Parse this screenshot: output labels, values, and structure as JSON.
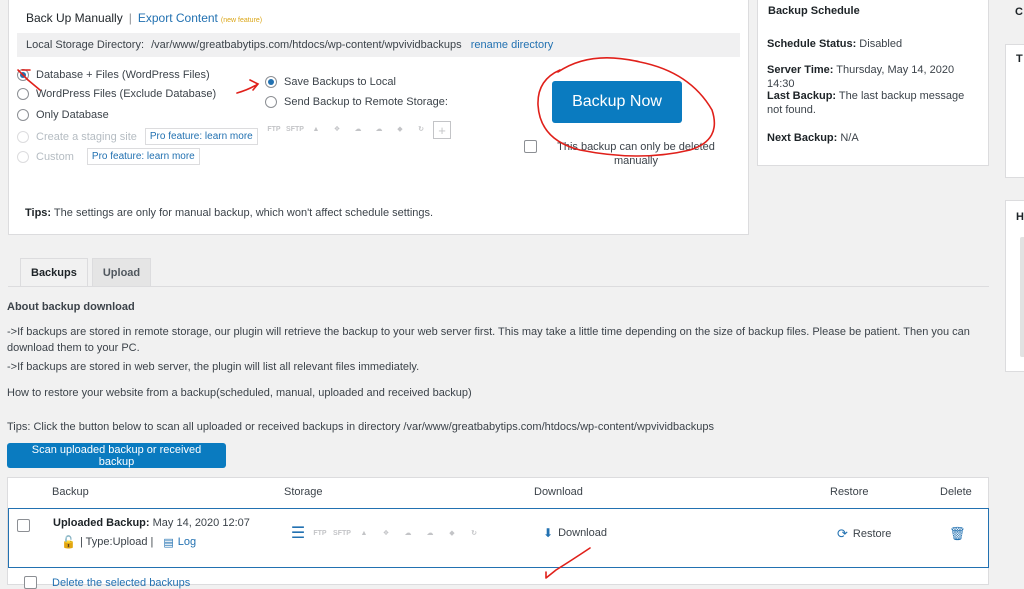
{
  "header": {
    "title": "Back Up Manually",
    "separator": "|",
    "export_link": "Export Content",
    "new_feature": "(new feature)"
  },
  "storage_dir": {
    "label": "Local Storage Directory:",
    "path": "/var/www/greatbabytips.com/htdocs/wp-content/wpvividbackups",
    "rename_link": "rename directory"
  },
  "backup_options": [
    {
      "label": "Database + Files (WordPress Files)",
      "checked": true,
      "disabled": false
    },
    {
      "label": "WordPress Files (Exclude Database)",
      "checked": false,
      "disabled": false
    },
    {
      "label": "Only Database",
      "checked": false,
      "disabled": false
    },
    {
      "label": "Create a staging site",
      "checked": false,
      "disabled": true,
      "pro": "Pro feature: learn more"
    },
    {
      "label": "Custom",
      "checked": false,
      "disabled": true,
      "pro": "Pro feature: learn more"
    }
  ],
  "destination": {
    "local_label": "Save Backups to Local",
    "remote_label": "Send Backup to Remote Storage:",
    "remote_icons": [
      "FTP",
      "SFTP",
      "google-drive-icon",
      "dropbox-icon",
      "onedrive-icon",
      "amazon-s3-icon",
      "digitalocean-icon",
      "sync-icon",
      "+"
    ]
  },
  "backup_now": {
    "label": "Backup Now",
    "keep_line1": "This backup can only be deleted",
    "keep_line2": "manually"
  },
  "tips_manual": {
    "bold": "Tips:",
    "text": " The settings are only for manual backup, which won't affect schedule settings."
  },
  "schedule": {
    "title": "Backup Schedule",
    "status_label": "Schedule Status:",
    "status_value": " Disabled",
    "time_label": "Server Time:",
    "time_value": " Thursday, May 14, 2020 14:30",
    "last_label": "Last Backup:",
    "last_value": " The last backup message not found.",
    "next_label": "Next Backup:",
    "next_value": " N/A"
  },
  "right_stubs": [
    "C",
    "T",
    "H"
  ],
  "tabs": [
    {
      "label": "Backups",
      "active": true
    },
    {
      "label": "Upload",
      "active": false
    }
  ],
  "about": {
    "heading": "About backup download",
    "line1a": "->If backups are stored in remote storage, our plugin will retrieve the backup to your web server first. This may take a little time depending on the size of backup files. Please be patient. Then you can",
    "line1b": "download them to your PC.",
    "line2": "->If backups are stored in web server, the plugin will list all relevant files immediately.",
    "restore_link": "How to restore your website from a backup(scheduled, manual, uploaded and received backup)"
  },
  "scan": {
    "tips": "Tips: Click the button below to scan all uploaded or received backups in directory /var/www/greatbabytips.com/htdocs/wp-content/wpvividbackups",
    "button": "Scan uploaded backup or received backup"
  },
  "table": {
    "headers": [
      "Backup",
      "Storage",
      "Download",
      "Restore",
      "Delete"
    ],
    "rows": [
      {
        "type_bold": "Uploaded Backup:",
        "date": " May 14, 2020 12:07",
        "type_line": "| Type:Upload |",
        "log": "Log",
        "storage_icons": [
          "local-storage-icon",
          "FTP",
          "SFTP",
          "google-drive-icon",
          "dropbox-icon",
          "onedrive-icon",
          "amazon-s3-icon",
          "digitalocean-icon",
          "sync-icon"
        ],
        "download": "Download",
        "restore": "Restore"
      }
    ],
    "delete_selected": "Delete the selected backups"
  },
  "colors": {
    "primary": "#0a7bc0",
    "link": "#2271b1",
    "annotation": "#e0201a"
  }
}
